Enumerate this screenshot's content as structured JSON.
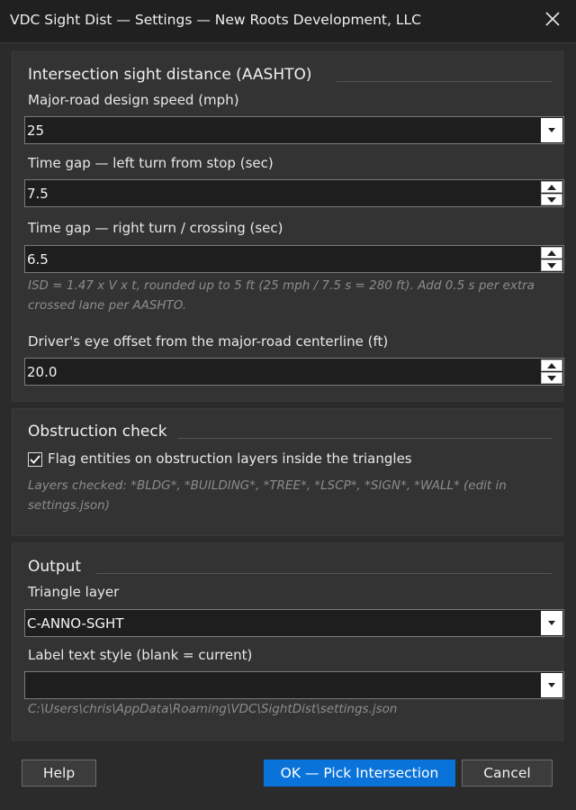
{
  "window": {
    "title": "VDC Sight Dist — Settings — New Roots Development, LLC",
    "close_icon": "close-icon"
  },
  "isd": {
    "group_title": "Intersection sight distance (AASHTO)",
    "speed_label": "Major-road design speed (mph)",
    "speed_value": "25",
    "gap_left_label": "Time gap — left turn from stop (sec)",
    "gap_left_value": "7.5",
    "gap_right_label": "Time gap — right turn / crossing (sec)",
    "gap_right_value": "6.5",
    "hint_line1": "ISD = 1.47 x V x t, rounded up to 5 ft (25 mph / 7.5 s = 280 ft). Add 0.5 s per extra",
    "hint_line2": "crossed lane per AASHTO.",
    "eye_offset_label": "Driver's eye offset from the major-road centerline (ft)",
    "eye_offset_value": "20.0"
  },
  "obstruction": {
    "group_title": "Obstruction check",
    "checkbox_label": "Flag entities on obstruction layers inside the triangles",
    "checked": true,
    "hint_line1": "Layers checked: *BLDG*, *BUILDING*, *TREE*, *LSCP*, *SIGN*, *WALL*  (edit in",
    "hint_line2": "settings.json)"
  },
  "output": {
    "group_title": "Output",
    "layer_label": "Triangle layer",
    "layer_value": "C-ANNO-SGHT",
    "style_label": "Label text style (blank = current)",
    "style_value": "",
    "settings_path": "C:\\Users\\chris\\AppData\\Roaming\\VDC\\SightDist\\settings.json"
  },
  "buttons": {
    "help": "Help",
    "ok": "OK — Pick Intersection",
    "cancel": "Cancel"
  },
  "colors": {
    "primary": "#0a73d9",
    "background": "#2b2b2b",
    "panel": "#333333",
    "field": "#1e1e1e"
  }
}
